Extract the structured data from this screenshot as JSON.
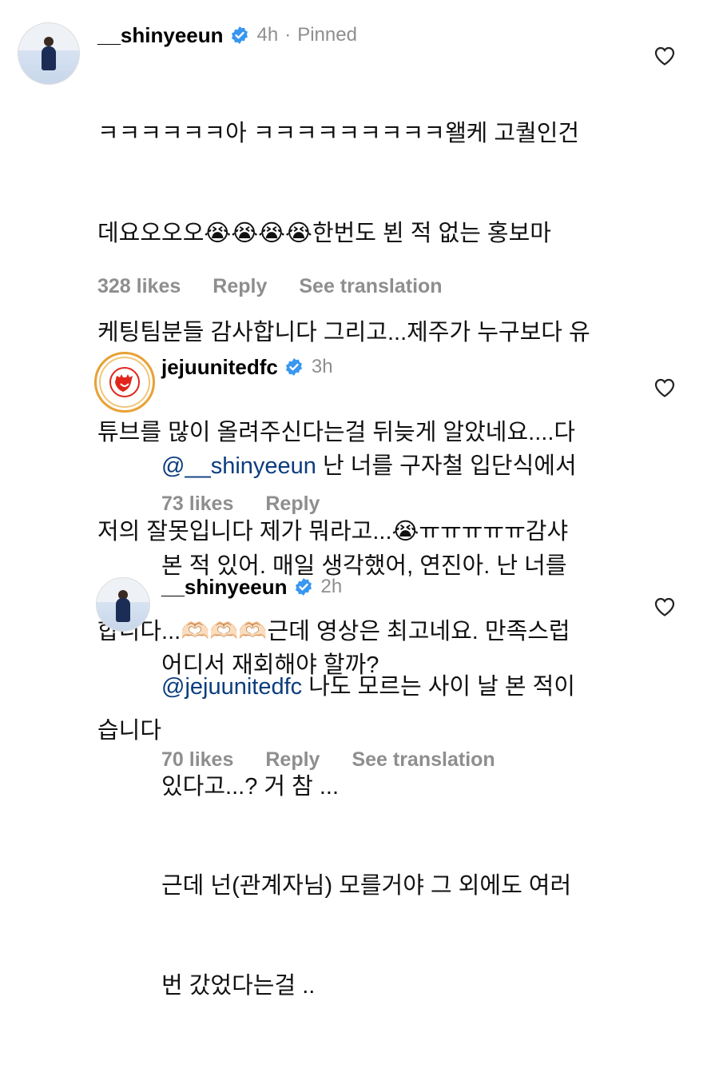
{
  "comments": [
    {
      "username": "__shinyeeun",
      "time": "4h",
      "pinned": "Pinned",
      "lines": [
        "ㅋㅋㅋㅋㅋㅋ아 ㅋㅋㅋㅋㅋㅋㅋㅋㅋ왤케 고퀄인건",
        "데요오오오😭😭😭😭한번도 뵌 적 없는 홍보마",
        "케팅팀분들 감사합니다 그리고...제주가 누구보다 유",
        "튜브를 많이 올려주신다는걸 뒤늦게 알았네요....다",
        "저의 잘못입니다 제가 뭐라고...😭ㅠㅠㅠㅠㅠ감샤",
        "합니다...🫶🏻🫶🏻🫶🏻근데 영상은 최고네요. 만족스럽",
        "습니다"
      ],
      "likes": "328 likes",
      "reply": "Reply",
      "translate": "See translation"
    },
    {
      "username": "jejuunitedfc",
      "time": "3h",
      "mention": "@__shinyeeun",
      "lines": [
        " 난 너를 구자철 입단식에서",
        "본 적 있어. 매일 생각했어, 연진아. 난 너를",
        "어디서 재회해야 할까?"
      ],
      "likes": "73 likes",
      "reply": "Reply"
    },
    {
      "username": "__shinyeeun",
      "time": "2h",
      "mention": "@jejuunitedfc",
      "lines": [
        " 나도 모르는 사이 날 본 적이",
        "있다고...? 거 참 ...",
        "근데 넌(관계자님) 모를거야 그 외에도 여러",
        "번 갔었다는걸 .."
      ],
      "likes": "70 likes",
      "reply": "Reply",
      "translate": "See translation"
    }
  ],
  "icons": {
    "verified": "verified-badge-icon",
    "like": "heart-icon"
  },
  "colors": {
    "verified": "#3897f0",
    "mention": "#0b3d7e",
    "meta": "#8e8e8e"
  }
}
